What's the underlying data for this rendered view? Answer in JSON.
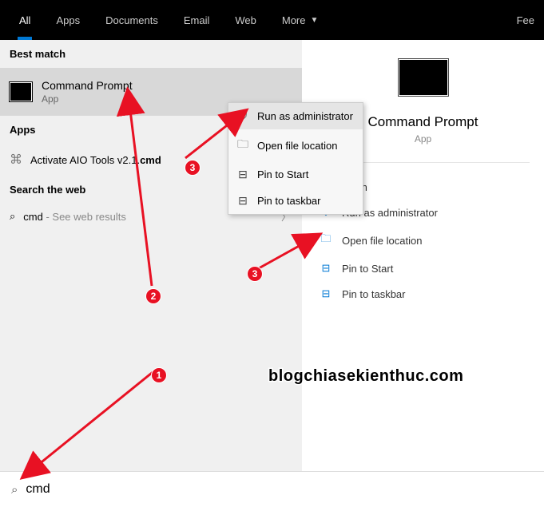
{
  "topbar": {
    "tabs": [
      "All",
      "Apps",
      "Documents",
      "Email",
      "Web",
      "More"
    ],
    "right": "Fee"
  },
  "left": {
    "best_hdr": "Best match",
    "best_match": {
      "title": "Command Prompt",
      "cat": "App"
    },
    "apps_hdr": "Apps",
    "app_row_prefix": "Activate AIO Tools v2.1.",
    "app_row_bold": "cmd",
    "web_hdr": "Search the web",
    "web_row_term": "cmd",
    "web_row_suffix": " - See web results"
  },
  "ctx": {
    "items": [
      {
        "icon": "⛨",
        "label": "Run as administrator"
      },
      {
        "icon": "🗀",
        "label": "Open file location"
      },
      {
        "icon": "⊟",
        "label": "Pin to Start"
      },
      {
        "icon": "⊟",
        "label": "Pin to taskbar"
      }
    ]
  },
  "right": {
    "title": "Command Prompt",
    "cat": "App",
    "actions": [
      {
        "icon": "▭",
        "label": "Open"
      },
      {
        "icon": "⛨",
        "label": "Run as administrator"
      },
      {
        "icon": "🗀",
        "label": "Open file location"
      },
      {
        "icon": "⊟",
        "label": "Pin to Start"
      },
      {
        "icon": "⊟",
        "label": "Pin to taskbar"
      }
    ]
  },
  "search": {
    "value": "cmd"
  },
  "badges": {
    "b1": "1",
    "b2": "2",
    "b3a": "3",
    "b3b": "3"
  },
  "watermark": "blogchiasekienthuc.com"
}
